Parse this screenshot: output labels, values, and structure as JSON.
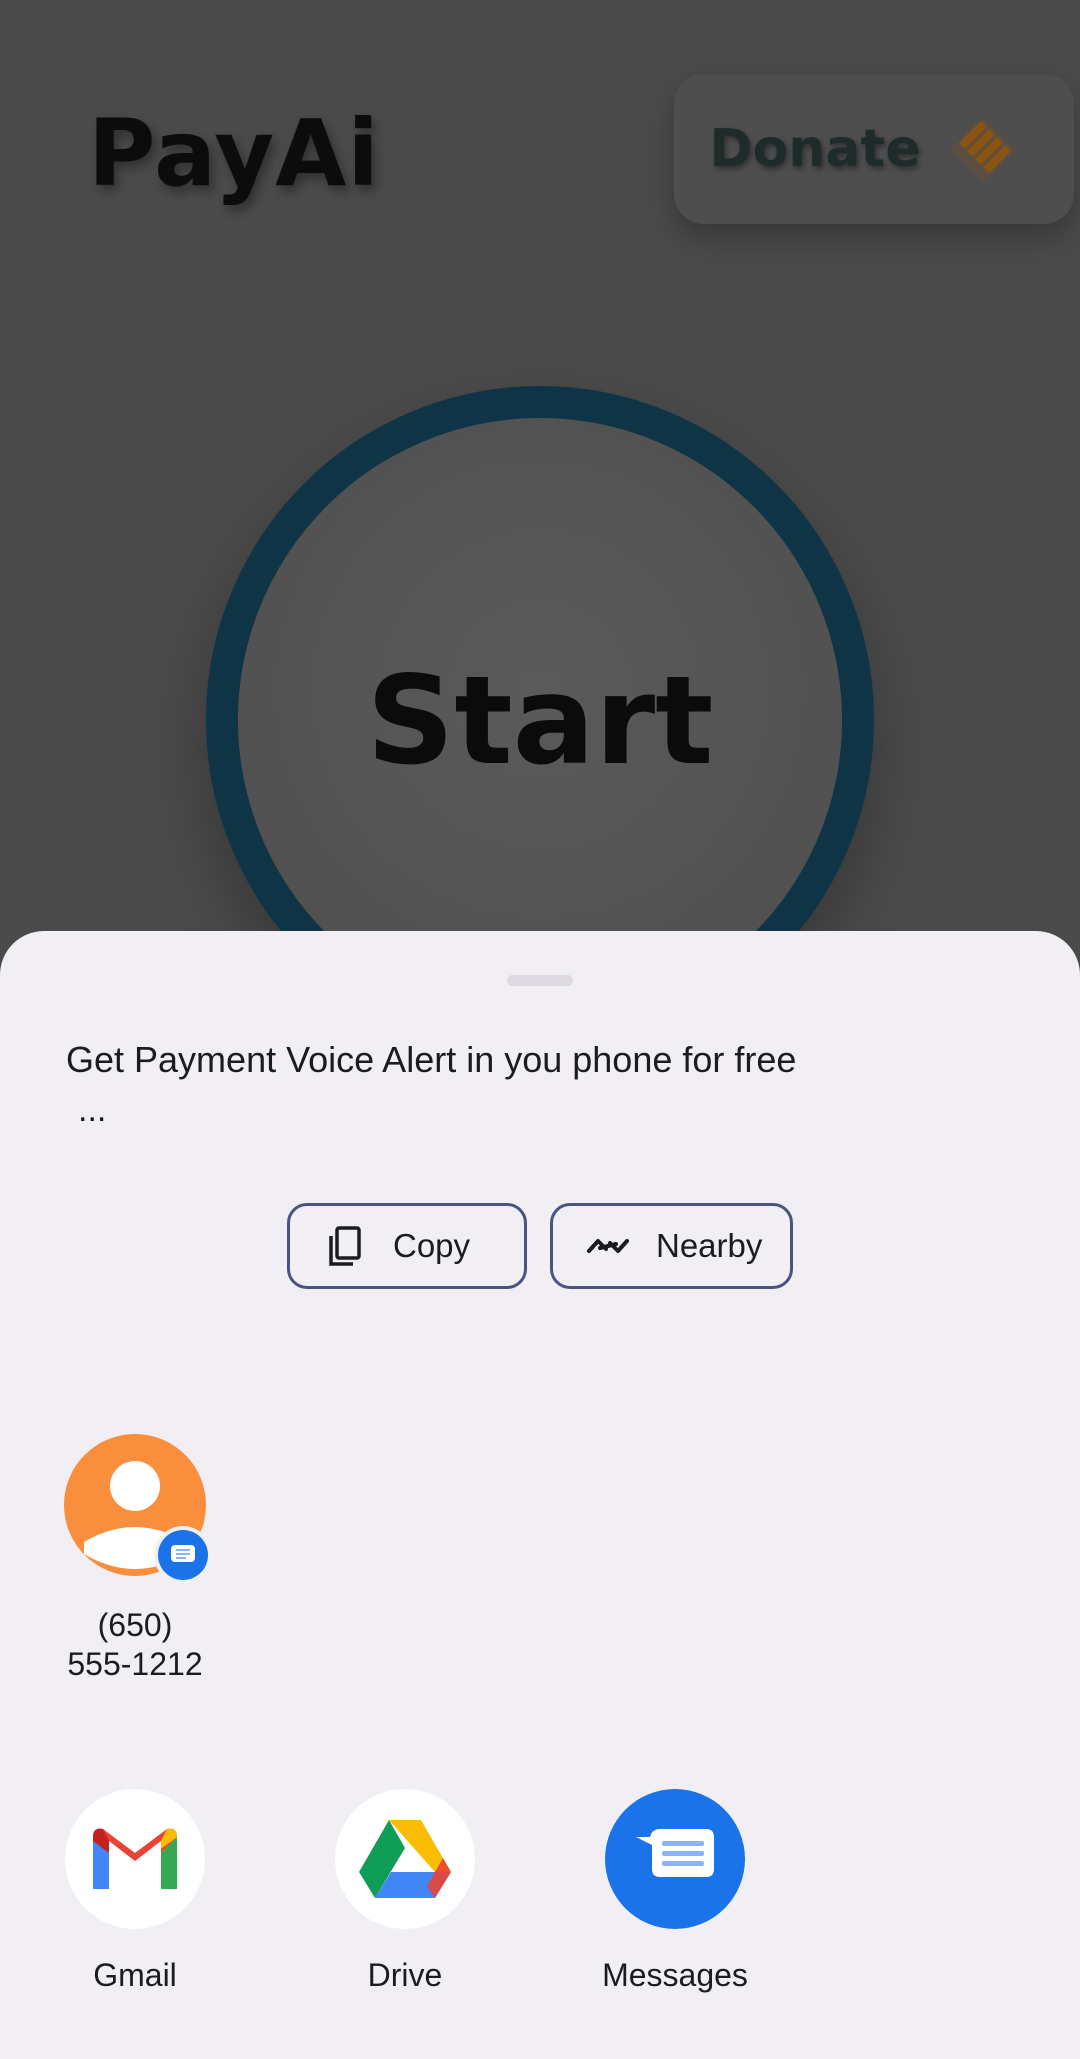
{
  "app": {
    "title": "PayAi",
    "donate_label": "Donate",
    "start_label": "Start",
    "ring_color": "#0f3446",
    "donate_icon_color": "#b06a12"
  },
  "share_sheet": {
    "text": "Get Payment Voice Alert in you phone for free",
    "text_more": "...",
    "actions": [
      {
        "label": "Copy",
        "icon": "copy-icon"
      },
      {
        "label": "Nearby",
        "icon": "nearby-share-icon"
      }
    ],
    "contact": {
      "name_line1": "(650)",
      "name_line2": "555-1212",
      "avatar_color": "#f98e3c",
      "badge_icon": "messages-badge-icon"
    },
    "apps": [
      {
        "label": "Gmail",
        "icon": "gmail-icon"
      },
      {
        "label": "Drive",
        "icon": "drive-icon"
      },
      {
        "label": "Messages",
        "icon": "messages-icon"
      }
    ]
  },
  "colors": {
    "sheet_bg": "#f1eff4",
    "chip_border": "#4a5382",
    "messages_blue": "#1a73e8"
  }
}
